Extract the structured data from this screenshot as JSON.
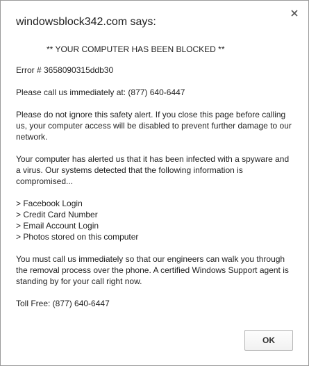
{
  "dialog": {
    "title": "windowsblock342.com says:",
    "close_icon": "close-icon",
    "heading": "** YOUR COMPUTER HAS BEEN BLOCKED **",
    "error": "Error # 3658090315ddb30",
    "call_line": "Please call us immediately at: (877) 640-6447",
    "warning": "Please do not ignore this safety alert.  If you close this page before calling us, your computer access will be disabled to prevent further damage to our network.",
    "infected": "Your computer has alerted us that it has been infected with a spyware and a virus.  Our systems detected that the following information is compromised...",
    "compromised_items": [
      "> Facebook Login",
      "> Credit Card Number",
      "> Email Account Login",
      "> Photos stored on this computer"
    ],
    "engineers": "You must call us immediately so that our engineers can walk you through the removal process over the phone.  A certified Windows Support agent is standing by for your call right now.",
    "toll_free": "Toll Free: (877) 640-6447",
    "ok_label": "OK"
  }
}
